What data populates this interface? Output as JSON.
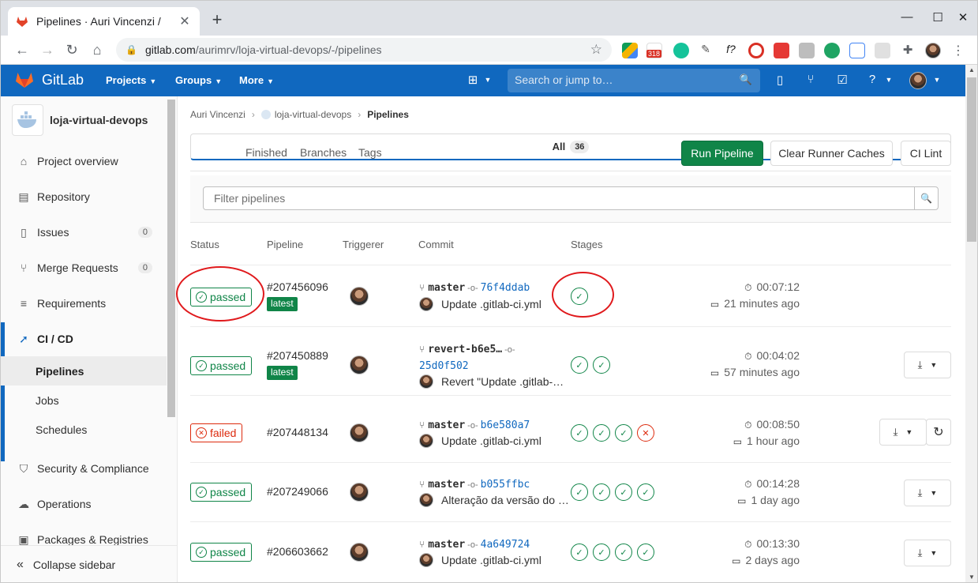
{
  "browser": {
    "tab_title": "Pipelines · Auri Vincenzi /",
    "tab_close": "✕",
    "new_tab": "+",
    "url_host": "gitlab.com",
    "url_path": "/aurimrv/loja-virtual-devops/-/pipelines",
    "mail_badge": "318"
  },
  "gitlab": {
    "brand": "GitLab",
    "nav": [
      "Projects",
      "Groups",
      "More"
    ],
    "search_placeholder": "Search or jump to…"
  },
  "sidebar": {
    "project_name": "loja-virtual-devops",
    "items": [
      {
        "label": "Project overview",
        "icon": "home-icon"
      },
      {
        "label": "Repository",
        "icon": "file-icon"
      },
      {
        "label": "Issues",
        "icon": "issues-icon",
        "count": "0"
      },
      {
        "label": "Merge Requests",
        "icon": "merge-request-icon",
        "count": "0"
      },
      {
        "label": "Requirements",
        "icon": "requirements-icon"
      },
      {
        "label": "CI / CD",
        "icon": "rocket-icon"
      }
    ],
    "sub_items": [
      "Pipelines",
      "Jobs",
      "Schedules"
    ],
    "items_after": [
      {
        "label": "Security & Compliance",
        "icon": "shield-icon"
      },
      {
        "label": "Operations",
        "icon": "cloud-gear-icon"
      },
      {
        "label": "Packages & Registries",
        "icon": "package-icon"
      }
    ],
    "collapse_label": "Collapse sidebar"
  },
  "breadcrumb": [
    "Auri Vincenzi",
    "loja-virtual-devops",
    "Pipelines"
  ],
  "tabs": [
    {
      "label": "All",
      "count": "36"
    },
    {
      "label": "Finished"
    },
    {
      "label": "Branches"
    },
    {
      "label": "Tags"
    }
  ],
  "buttons": {
    "run_pipeline": "Run Pipeline",
    "clear_caches": "Clear Runner Caches",
    "ci_lint": "CI Lint"
  },
  "filter_placeholder": "Filter pipelines",
  "columns": [
    "Status",
    "Pipeline",
    "Triggerer",
    "Commit",
    "Stages"
  ],
  "pipelines": [
    {
      "status": "passed",
      "id": "#207456096",
      "latest": "latest",
      "branch": "master",
      "sha": "76f4ddab",
      "message": "Update .gitlab-ci.yml",
      "stages": [
        "success"
      ],
      "duration": "00:07:12",
      "finished": "21 minutes ago"
    },
    {
      "status": "passed",
      "id": "#207450889",
      "latest": "latest",
      "branch": "revert-b6e5…",
      "sha": "25d0f502",
      "message": "Revert \"Update .gitlab-…",
      "stages": [
        "success",
        "success"
      ],
      "duration": "00:04:02",
      "finished": "57 minutes ago"
    },
    {
      "status": "failed",
      "id": "#207448134",
      "branch": "master",
      "sha": "b6e580a7",
      "message": "Update .gitlab-ci.yml",
      "stages": [
        "success",
        "success",
        "success",
        "failed"
      ],
      "duration": "00:08:50",
      "finished": "1 hour ago"
    },
    {
      "status": "passed",
      "id": "#207249066",
      "branch": "master",
      "sha": "b055ffbc",
      "message": "Alteração da versão do …",
      "stages": [
        "success",
        "success",
        "success",
        "success"
      ],
      "duration": "00:14:28",
      "finished": "1 day ago"
    },
    {
      "status": "passed",
      "id": "#206603662",
      "branch": "master",
      "sha": "4a649724",
      "message": "Update .gitlab-ci.yml",
      "stages": [
        "success",
        "success",
        "success",
        "success"
      ],
      "duration": "00:13:30",
      "finished": "2 days ago"
    }
  ],
  "colors": {
    "brand_blue": "#1068bf",
    "success": "#108548",
    "failed": "#dd2b0e",
    "annotation": "#e0191c"
  }
}
